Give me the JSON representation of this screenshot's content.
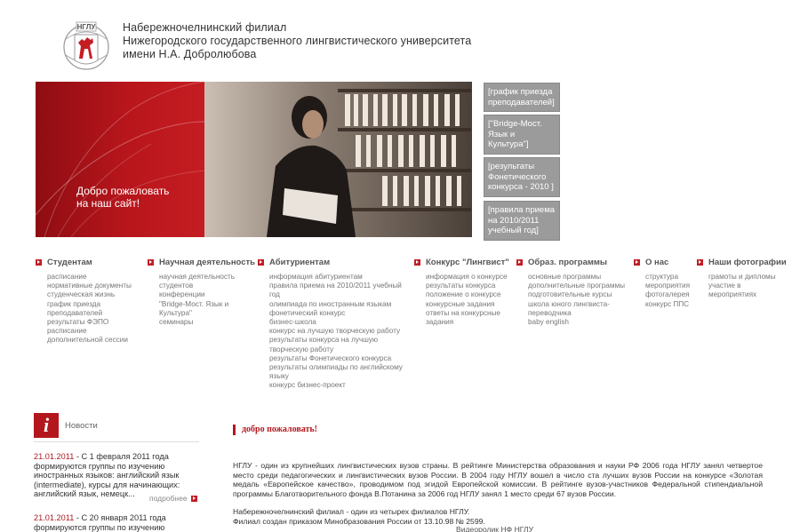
{
  "header": {
    "logo_text": "НГЛУ",
    "title_lines": [
      "Набережночелнинский филиал",
      "Нижегородского  государственного лингвистического университета",
      "имени Н.А. Добролюбова"
    ]
  },
  "banner": {
    "welcome_line1": "Добро пожаловать",
    "welcome_line2": "на наш сайт!"
  },
  "promos": [
    {
      "line1": "[график приезда",
      "line2": "преподавателей]",
      "line3": "",
      "line4": ""
    },
    {
      "line1": "[\"Bridge-Мост.",
      "line2": "Язык и",
      "line3": "Культура\"]",
      "line4": ""
    },
    {
      "line1": "[результаты",
      "line2": "Фонетического",
      "line3": "конкурса - 2010 ]",
      "line4": ""
    },
    {
      "line1": "[правила приема",
      "line2": "на 2010/2011",
      "line3": "учебный год]",
      "line4": ""
    }
  ],
  "nav": [
    {
      "title": "Студентам",
      "items": [
        "расписание",
        "нормативные документы",
        "студенческая жизнь",
        "график приезда",
        "преподавателей",
        "результаты ФЭПО",
        "расписание",
        "дополнительной сессии"
      ]
    },
    {
      "title": "Научная деятельность",
      "items": [
        "научная деятельность",
        "студентов",
        "конференции",
        "\"Bridge-Мост. Язык и",
        "Культура\"",
        "семинары"
      ]
    },
    {
      "title": "Абитуриентам",
      "items": [
        "информация абитуриентам",
        "правила приема на 2010/2011 учебный",
        "год",
        "олимпиада по иностранным языкам",
        "фонетический конкурс",
        "бизнес-школа",
        "конкурс на лучшую творческую работу",
        "результаты конкурса на лучшую",
        "творческую работу",
        "результаты Фонетического конкурса",
        "результаты олимпиады по английскому",
        "языку",
        "конкурс бизнес-проект"
      ]
    },
    {
      "title": "Конкурс \"Лингвист\"",
      "items": [
        "информация о конкурсе",
        "результаты конкурса",
        "положение о конкурсе",
        "конкурсные задания",
        "ответы на конкурсные",
        "задания"
      ]
    },
    {
      "title": "Образ. программы",
      "items": [
        "основные программы",
        "дополнительные программы",
        "подготовительные курсы",
        "школа юного лингвиста-",
        "переводчика",
        "baby english"
      ]
    },
    {
      "title": "О нас",
      "items": [
        "структура",
        "мероприятия",
        "фотогалерея",
        "конкурс ППС"
      ]
    },
    {
      "title": "Наши фотографии",
      "items": [
        "грамоты и дипломы",
        "участие в",
        "мероприятиях"
      ]
    }
  ],
  "news": {
    "label": "Новости",
    "icon_letter": "i",
    "items": [
      {
        "date": "21.01.2011",
        "text1": " - С 1 февраля 2011 года",
        "lines": [
          "формируются группы по изучению",
          "иностранных языков: английский язык",
          "(intermediate), курсы для начинающих:",
          "английский язык, немецк..."
        ],
        "more": "подробнее"
      },
      {
        "date": "21.01.2011",
        "text1": " - С 20 января 2011 года",
        "lines": [
          "формируются группы по изучению"
        ],
        "more": ""
      }
    ]
  },
  "main": {
    "heading": "добро пожаловать!",
    "para1": "НГЛУ - один из крупнейших лингвистических вузов страны. В рейтинге Министерства образования и науки РФ 2006 года НГЛУ занял четвертое место среди педагогических и лингвистических вузов России. В 2004 году НГЛУ вошел в число ста лучших вузов России на конкурсе «Золотая медаль «Европейское качество», проводимом под эгидой Европейской комиссии. В рейтинге вузов-участников Федеральной стипендиальной программы Благотворительного фонда В.Потанина за 2006 год НГЛУ занял 1 место среди 67 вузов России.",
    "para2_line1": "Набережночелнинский филиал - один из четырех филиалов НГЛУ.",
    "para2_line2": "Филиал создан приказом Минобразования России от 13.10.98 № 2599.",
    "video": "Видеоролик НФ НГЛУ"
  },
  "colors": {
    "brand_red": "#b3171d",
    "promo_gray": "#9b9b9b"
  }
}
